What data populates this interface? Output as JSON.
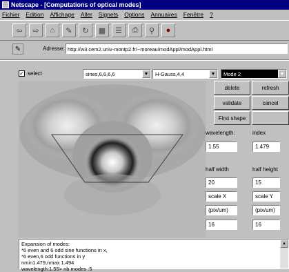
{
  "window": {
    "title": "Netscape - [Computations of optical modes]"
  },
  "menu": [
    "Fichier",
    "Edition",
    "Affichage",
    "Aller",
    "Signets",
    "Options",
    "Annuaires",
    "Fenêtre",
    "?"
  ],
  "toolbar": {
    "buttons": [
      {
        "name": "back-icon",
        "glyph": "⇦"
      },
      {
        "name": "forward-icon",
        "glyph": "⇨"
      },
      {
        "name": "home-icon",
        "glyph": "⌂"
      },
      {
        "name": "edit-icon",
        "glyph": "✎"
      },
      {
        "name": "reload-icon",
        "glyph": "↻"
      },
      {
        "name": "images-icon",
        "glyph": "▦"
      },
      {
        "name": "open-icon",
        "glyph": "☰"
      },
      {
        "name": "print-icon",
        "glyph": "⎙"
      },
      {
        "name": "find-icon",
        "glyph": "⚲"
      },
      {
        "name": "stop-icon",
        "glyph": "●"
      }
    ]
  },
  "address": {
    "label": "Adresse:",
    "url": "http://w3.cem2.univ-montp2.fr/~moreau/modAppl/modAppl.html"
  },
  "applet": {
    "select_label": "select",
    "select_checked": true,
    "dropdown1": "sines,6,6,6,6",
    "dropdown2": "H-Gauss,4,4",
    "dropdown3": "Mode 2",
    "buttons": {
      "delete": "delete",
      "refresh": "refresh",
      "validate": "validate",
      "cancel": "cancel",
      "first_shape": "First shape"
    },
    "wavelength_label": "wavelength:",
    "index_label": "index",
    "wavelength_value": "1.55",
    "index_value": "1.479",
    "half_width_label": "half width",
    "half_height_label": "half height",
    "half_width_value": "20",
    "half_height_value": "15",
    "scale_x": "scale X",
    "scale_y": "scale Y",
    "unit_x": "(pix/um)",
    "unit_y": "(pix/um)",
    "scale_x_value": "16",
    "scale_y_value": "16"
  },
  "output": {
    "lines": [
      "Expansion of modes:",
      "*6 even and 6 odd sine functions in x,",
      "*6 even,6 odd functions in y",
      "nmin1.479,nmax 1.494",
      "wavelength:1.55> nb modes :5"
    ]
  },
  "colors": {
    "titlebar": "#000080",
    "background": "#c0c0c0"
  }
}
